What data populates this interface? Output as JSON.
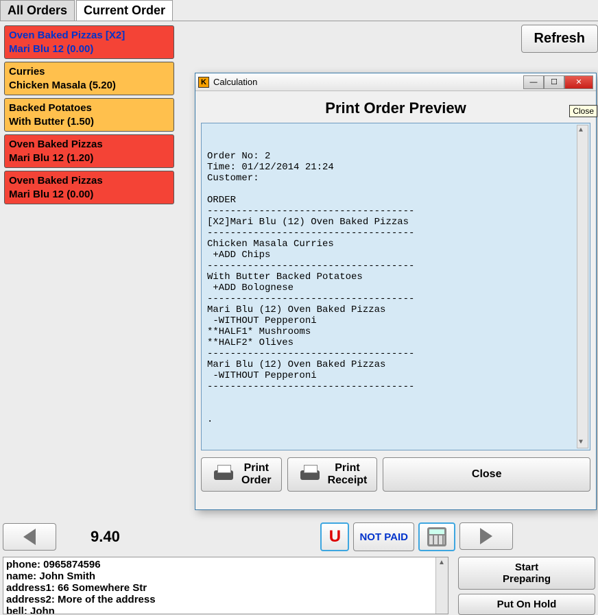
{
  "tabs": {
    "all": "All Orders",
    "current": "Current Order"
  },
  "refresh_label": "Refresh",
  "order_items": [
    {
      "line1": "Oven Baked Pizzas [X2]",
      "line2": "Mari Blu 12 (0.00)",
      "cls": "item-red selected"
    },
    {
      "line1": "Curries",
      "line2": "Chicken Masala  (5.20)",
      "cls": "item-orange"
    },
    {
      "line1": "Backed Potatoes",
      "line2": "With Butter  (1.50)",
      "cls": "item-orange"
    },
    {
      "line1": "Oven Baked Pizzas",
      "line2": "Mari Blu 12 (1.20)",
      "cls": "item-red"
    },
    {
      "line1": "Oven Baked Pizzas",
      "line2": "Mari Blu 12 (0.00)",
      "cls": "item-red"
    }
  ],
  "total": "9.40",
  "toolbar": {
    "u": "U",
    "not_paid": "NOT PAID"
  },
  "customer": {
    "phone": "phone: 0965874596",
    "name": "name: John Smith",
    "address1": "address1: 66 Somewhere Str",
    "address2": "address2: More of the address",
    "bell": "bell: John"
  },
  "actions": {
    "start_preparing": "Start Preparing",
    "put_on_hold": "Put On Hold"
  },
  "dialog": {
    "window_title": "Calculation",
    "close_tip": "Close",
    "title": "Print Order Preview",
    "preview": "\n\nOrder No: 2\nTime: 01/12/2014 21:24\nCustomer:\n\nORDER\n------------------------------------\n[X2]Mari Blu (12) Oven Baked Pizzas\n------------------------------------\nChicken Masala Curries\n +ADD Chips\n------------------------------------\nWith Butter Backed Potatoes\n +ADD Bolognese\n------------------------------------\nMari Blu (12) Oven Baked Pizzas\n -WITHOUT Pepperoni\n**HALF1* Mushrooms\n**HALF2* Olives\n------------------------------------\nMari Blu (12) Oven Baked Pizzas\n -WITHOUT Pepperoni\n------------------------------------\n\n\n.",
    "print_order": "Print\nOrder",
    "print_receipt": "Print\nReceipt",
    "close": "Close"
  }
}
